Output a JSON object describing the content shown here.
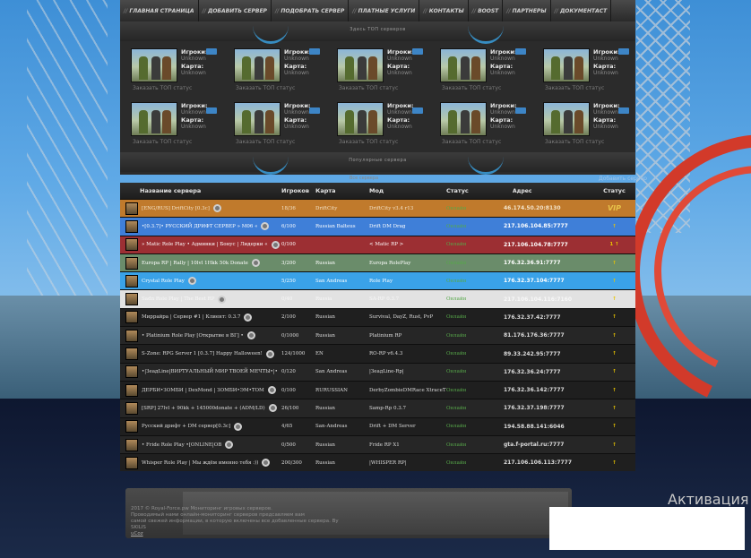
{
  "nav": [
    "Главная страница",
    "Добавить сервер",
    "Подобрать сервер",
    "Платные услуги",
    "Контакты",
    "Boost",
    "Партнеры",
    "Документаст"
  ],
  "top_banner": "Здесь ТОП серверов",
  "mid_banner": "Популярные сервера",
  "cards_row1": [
    {
      "players": "Игроки:",
      "players_val": "Unknown",
      "map": "Карта:",
      "map_val": "Unknown",
      "order": "Заказать ТОП статус"
    },
    {
      "players": "Игроки:",
      "players_val": "Unknown",
      "map": "Карта:",
      "map_val": "Unknown",
      "order": "Заказать ТОП статус"
    },
    {
      "players": "Игроки:",
      "players_val": "Unknown",
      "map": "Карта:",
      "map_val": "Unknown",
      "order": "Заказать ТОП статус"
    },
    {
      "players": "Игроки:",
      "players_val": "Unknown",
      "map": "Карта:",
      "map_val": "Unknown",
      "order": "Заказать ТОП статус"
    },
    {
      "players": "Игроки:",
      "players_val": "Unknown",
      "map": "Карта:",
      "map_val": "Unknown",
      "order": "Заказать ТОП статус"
    }
  ],
  "cards_row2": [
    {
      "players": "Игроки:",
      "players_val": "Unknown",
      "map": "Карта:",
      "map_val": "Unknown",
      "order": "Заказать ТОП статус"
    },
    {
      "players": "Игроки:",
      "players_val": "Unknown",
      "map": "Карта:",
      "map_val": "Unknown",
      "order": "Заказать ТОП статус"
    },
    {
      "players": "Игроки:",
      "players_val": "Unknown",
      "map": "Карта:",
      "map_val": "Unknown",
      "order": "Заказать ТОП статус"
    },
    {
      "players": "Игроки:",
      "players_val": "Unknown",
      "map": "Карта:",
      "map_val": "Unknown",
      "order": "Заказать ТОП статус"
    },
    {
      "players": "Игроки:",
      "players_val": "Unknown",
      "map": "Карта:",
      "map_val": "Unknown",
      "order": "Заказать ТОП статус"
    }
  ],
  "add_link": "Добавить сервер",
  "breadcrumb": "Все сервера",
  "table": {
    "headers": {
      "name": "Название сервера",
      "players": "Игроков",
      "map": "Карта",
      "mod": "Мод",
      "status": "Статус",
      "address": "Адрес",
      "rating": "Статус"
    },
    "rows": [
      {
        "name": "[ENG/RUS] DriftCity [0.3c]",
        "players": "18/36",
        "map": "DriftCity",
        "mod": "DriftCity v3.4 r13",
        "status": "Онлайн",
        "address": "46.174.50.20:8130",
        "rating": "VIP",
        "bg": "#c07a2c",
        "color": "#f3e3c8"
      },
      {
        "name": "•[0.3.7]• РУССКИЙ ДРИФТ СЕРВЕР » M06 «",
        "players": "6/100",
        "map": "Russian Balteus",
        "mod": "Drift DM Drag",
        "status": "Онлайн",
        "address": "217.106.104.85:7777",
        "rating": "↑",
        "bg": "#3f7fd8",
        "color": "#ffffff"
      },
      {
        "name": "» Matic Role Play • Админки | Бонус | Лидерки «",
        "players": "0/100",
        "map": "",
        "mod": "< Matic RP >",
        "status": "Онлайн",
        "address": "217.106.104.78:7777",
        "rating": "1 ↑",
        "bg": "#9c2f33",
        "color": "#ffffff"
      },
      {
        "name": "Europa RP | Rally | 10lvl 1Hkk 50k Donate",
        "players": "3/200",
        "map": "Russian",
        "mod": "Europa RolePlay",
        "status": "Онлайн",
        "address": "176.32.36.91:7777",
        "rating": "↑",
        "bg": "#6a8c6a",
        "color": "#ffffff"
      },
      {
        "name": "Crystal Role Play",
        "players": "5/250",
        "map": "San Andreas",
        "mod": "Role Play",
        "status": "Онлайн",
        "address": "176.32.37.104:7777",
        "rating": "↑",
        "bg": "#3aa2e8",
        "color": "#ffffff"
      },
      {
        "name": "Sadn Role Play | The Best RP",
        "players": "0/40",
        "map": "Russia",
        "mod": "SA-RP 0.3.7",
        "status": "Онлайн",
        "address": "217.106.104.116:7160",
        "rating": "↑",
        "bg": "#e2e2e2",
        "color": "#f8f8f8"
      },
      {
        "name": "Миррайра | Сервер #1 | Клиент: 0.3.7",
        "players": "2/100",
        "map": "Russian",
        "mod": "Survival, DayZ, Rust, PvP",
        "status": "Онлайн",
        "address": "176.32.37.42:7777",
        "rating": "↑",
        "bg": "#1f1f1f",
        "color": "#dcdcdc"
      },
      {
        "name": "• Platinium Role Play [Открытие в ВГ] •",
        "players": "0/1000",
        "map": "Russian",
        "mod": "Platinium RP",
        "status": "Онлайн",
        "address": "81.176.176.36:7777",
        "rating": "↑",
        "bg": "#262626",
        "color": "#dcdcdc"
      },
      {
        "name": "S-Zone: RPG Server 1 [0.3.7] Happy Halloween!",
        "players": "124/1000",
        "map": "EN",
        "mod": "RO-RP v6.4.3",
        "status": "Онлайн",
        "address": "89.33.242.95:7777",
        "rating": "↑",
        "bg": "#1f1f1f",
        "color": "#dcdcdc"
      },
      {
        "name": "•|ЗеадLine|ВИРТУАЛЬНЫЙ МИР ТВОЕЙ МЕЧТЫ•|•",
        "players": "0/120",
        "map": "San Andreas",
        "mod": "|ЗеадLine-Rp|",
        "status": "Онлайн",
        "address": "176.32.36.24:7777",
        "rating": "↑",
        "bg": "#262626",
        "color": "#dcdcdc"
      },
      {
        "name": "ДЕРБИ•ЗОМБИ | DexMond | ЗОМБИ•ЭМ•ТОМ",
        "players": "0/100",
        "map": "RURUSSIAN",
        "mod": "DerbyZombieDMRace XtraceTDM",
        "status": "Онлайн",
        "address": "176.32.36.142:7777",
        "rating": "↑",
        "bg": "#1f1f1f",
        "color": "#dcdcdc"
      },
      {
        "name": "[SRP] 27lvl + 90kk + 145000donate + (ADM/LD)",
        "players": "26/100",
        "map": "Russian",
        "mod": "Samp-Rp 0.3.7",
        "status": "Онлайн",
        "address": "176.32.37.198:7777",
        "rating": "↑",
        "bg": "#262626",
        "color": "#dcdcdc"
      },
      {
        "name": "Русский дрифт + DM сервер[0.3c]",
        "players": "4/65",
        "map": "San-Andreas",
        "mod": "Drift + DM Server",
        "status": "Онлайн",
        "address": "194.58.88.141:6046",
        "rating": "↑",
        "bg": "#1f1f1f",
        "color": "#dcdcdc"
      },
      {
        "name": "• Fride Role Play •[ONLINE|OВ",
        "players": "0/500",
        "map": "Russian",
        "mod": "Fride RP X1",
        "status": "Онлайн",
        "address": "gta.f-portal.ru:7777",
        "rating": "↑",
        "bg": "#262626",
        "color": "#dcdcdc"
      },
      {
        "name": "Whisper Role Play | Мы ждём именно тебя :))",
        "players": "200/300",
        "map": "Russian",
        "mod": "|WHISPER RP|",
        "status": "Онлайн",
        "address": "217.106.106.113:7777",
        "rating": "↑",
        "bg": "#1f1f1f",
        "color": "#dcdcdc"
      }
    ]
  },
  "footer": {
    "line1": "2017 © Royal-Force.pw Мониторинг игровых серверов.",
    "line2": "Проводимый нами онлайн-мониторинг серверов предсавляем вам",
    "line3": "самой свежей информации, в которую включены все добавленные сервера. By SKILIS",
    "link": "uCoz"
  },
  "activation": "Активация"
}
